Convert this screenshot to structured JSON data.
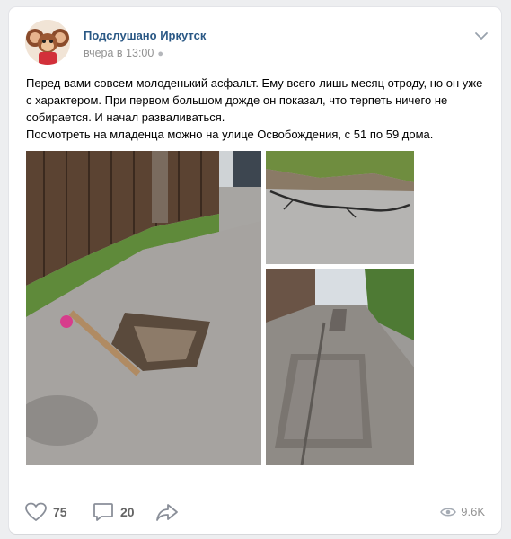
{
  "post": {
    "author": "Подслушано Иркутск",
    "time": "вчера в 13:00",
    "text_lines": [
      "Перед вами совсем молоденький асфальт. Ему всего лишь месяц отроду, но он уже с характером. При первом большом дожде он показал, что терпеть ничего не собирается. И начал разваливаться.",
      "Посмотреть на младенца можно на улице Освобождения, с 51 по 59 дома."
    ]
  },
  "actions": {
    "likes": "75",
    "comments": "20",
    "views": "9.6K"
  },
  "colors": {
    "link": "#2a5885",
    "muted": "#939393",
    "icon": "#8a8f99"
  },
  "icons": [
    "chevron-down-icon",
    "heart-icon",
    "comment-icon",
    "share-icon",
    "eye-icon"
  ]
}
